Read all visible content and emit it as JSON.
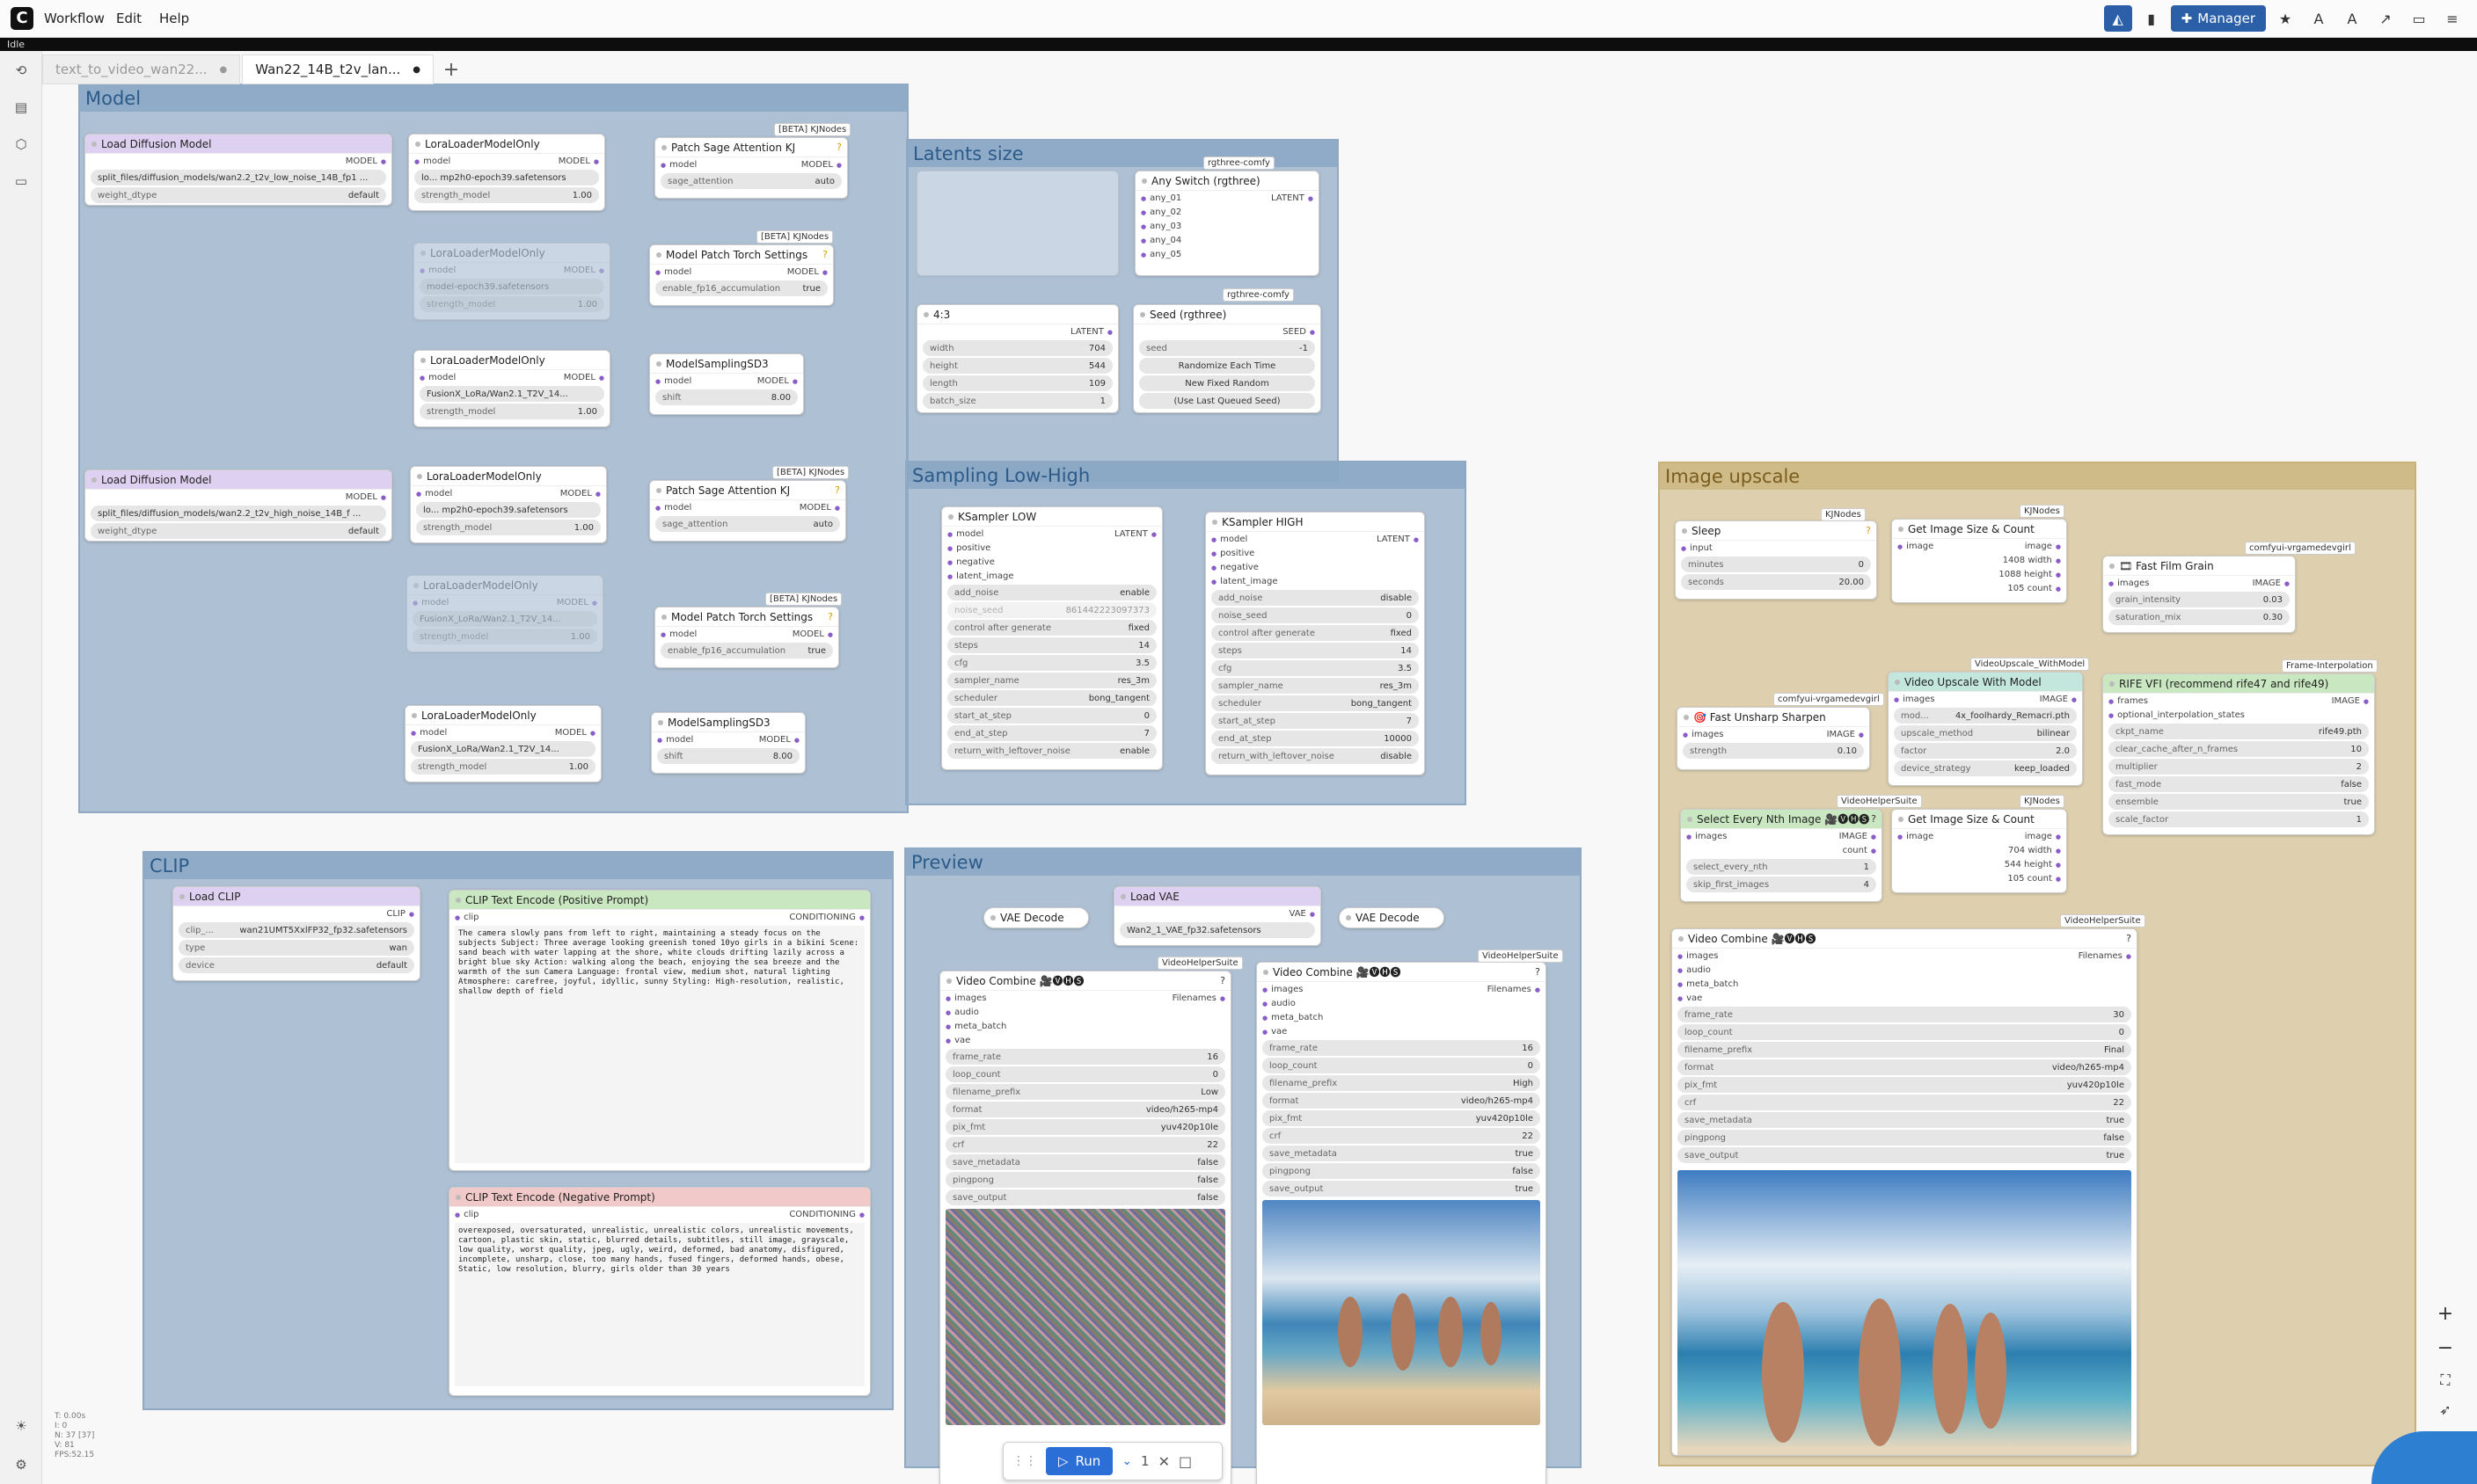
{
  "menu": {
    "items": [
      "Workflow",
      "Edit",
      "Help"
    ],
    "manager": "Manager"
  },
  "status": "Idle",
  "tabs": [
    {
      "label": "text_to_video_wan22...",
      "active": false
    },
    {
      "label": "Wan22_14B_t2v_lan...",
      "active": true
    }
  ],
  "groups": {
    "model": "Model",
    "latents": "Latents size",
    "sampling": "Sampling Low-High",
    "upscale": "Image upscale",
    "clip": "CLIP",
    "preview": "Preview"
  },
  "nodes": {
    "ldm1": {
      "title": "Load Diffusion Model",
      "out": "MODEL",
      "w1": "split_files/diffusion_models/wan2.2_t2v_low_noise_14B_fp1 ...",
      "w2n": "weight_dtype",
      "w2v": "default"
    },
    "ldm2": {
      "title": "Load Diffusion Model",
      "out": "MODEL",
      "w1": "split_files/diffusion_models/wan2.2_t2v_high_noise_14B_f ...",
      "w2n": "weight_dtype",
      "w2v": "default"
    },
    "lora1": {
      "title": "LoraLoaderModelOnly",
      "in": "model",
      "out": "MODEL",
      "w1": "lo... mp2h0-epoch39.safetensors",
      "w2n": "strength_model",
      "w2v": "1.00"
    },
    "lora2": {
      "title": "LoraLoaderModelOnly",
      "in": "model",
      "out": "MODEL",
      "w1": "model-epoch39.safetensors",
      "w2n": "strength_model",
      "w2v": "1.00"
    },
    "lora3": {
      "title": "LoraLoaderModelOnly",
      "in": "model",
      "out": "MODEL",
      "w1": "FusionX_LoRa/Wan2.1_T2V_14...",
      "w2n": "strength_model",
      "w2v": "1.00"
    },
    "lora4": {
      "title": "LoraLoaderModelOnly",
      "in": "model",
      "out": "MODEL",
      "w1": "lo... mp2h0-epoch39.safetensors",
      "w2n": "strength_model",
      "w2v": "1.00"
    },
    "lora5": {
      "title": "LoraLoaderModelOnly",
      "in": "model",
      "out": "MODEL",
      "w1": "FusionX_LoRa/Wan2.1_T2V_14...",
      "w2n": "strength_model",
      "w2v": "1.00"
    },
    "lora6": {
      "title": "LoraLoaderModelOnly",
      "in": "model",
      "out": "MODEL",
      "w1": "FusionX_LoRa/Wan2.1_T2V_14...",
      "w2n": "strength_model",
      "w2v": "1.00"
    },
    "psa1": {
      "title": "Patch Sage Attention KJ",
      "badge": "[BETA] KJNodes",
      "in": "model",
      "out": "MODEL",
      "w1n": "sage_attention",
      "w1v": "auto"
    },
    "psa2": {
      "title": "Patch Sage Attention KJ",
      "badge": "[BETA] KJNodes",
      "in": "model",
      "out": "MODEL",
      "w1n": "sage_attention",
      "w1v": "auto"
    },
    "mpt1": {
      "title": "Model Patch Torch Settings",
      "badge": "[BETA] KJNodes",
      "in": "model",
      "out": "MODEL",
      "w1n": "enable_fp16_accumulation",
      "w1v": "true"
    },
    "mpt2": {
      "title": "Model Patch Torch Settings",
      "badge": "[BETA] KJNodes",
      "in": "model",
      "out": "MODEL",
      "w1n": "enable_fp16_accumulation",
      "w1v": "true"
    },
    "msd1": {
      "title": "ModelSamplingSD3",
      "in": "model",
      "out": "MODEL",
      "w1n": "shift",
      "w1v": "8.00"
    },
    "msd2": {
      "title": "ModelSamplingSD3",
      "in": "model",
      "out": "MODEL",
      "w1n": "shift",
      "w1v": "8.00"
    },
    "anysw": {
      "title": "Any Switch (rgthree)",
      "badge": "rgthree-comfy",
      "out": "LATENT",
      "ins": [
        "any_01",
        "any_02",
        "any_03",
        "any_04",
        "any_05"
      ]
    },
    "ratio": {
      "title": "4:3",
      "out": "LATENT",
      "w": [
        [
          "width",
          "704"
        ],
        [
          "height",
          "544"
        ],
        [
          "length",
          "109"
        ],
        [
          "batch_size",
          "1"
        ]
      ]
    },
    "seed": {
      "title": "Seed (rgthree)",
      "badge": "rgthree-comfy",
      "out": "SEED",
      "w1n": "seed",
      "w1v": "-1",
      "b1": "Randomize Each Time",
      "b2": "New Fixed Random",
      "b3": "(Use Last Queued Seed)"
    },
    "ksl": {
      "title": "KSampler LOW",
      "out": "LATENT",
      "ins": [
        "model",
        "positive",
        "negative",
        "latent_image"
      ],
      "w": [
        [
          "add_noise",
          "enable"
        ],
        [
          "noise_seed",
          "861442223097373"
        ],
        [
          "control after generate",
          "fixed"
        ],
        [
          "steps",
          "14"
        ],
        [
          "cfg",
          "3.5"
        ],
        [
          "sampler_name",
          "res_3m"
        ],
        [
          "scheduler",
          "bong_tangent"
        ],
        [
          "start_at_step",
          "0"
        ],
        [
          "end_at_step",
          "7"
        ],
        [
          "return_with_leftover_noise",
          "enable"
        ]
      ]
    },
    "ksh": {
      "title": "KSampler HIGH",
      "out": "LATENT",
      "ins": [
        "model",
        "positive",
        "negative",
        "latent_image"
      ],
      "w": [
        [
          "add_noise",
          "disable"
        ],
        [
          "noise_seed",
          "0"
        ],
        [
          "control after generate",
          "fixed"
        ],
        [
          "steps",
          "14"
        ],
        [
          "cfg",
          "3.5"
        ],
        [
          "sampler_name",
          "res_3m"
        ],
        [
          "scheduler",
          "bong_tangent"
        ],
        [
          "start_at_step",
          "7"
        ],
        [
          "end_at_step",
          "10000"
        ],
        [
          "return_with_leftover_noise",
          "disable"
        ]
      ]
    },
    "clip": {
      "title": "Load CLIP",
      "out": "CLIP",
      "w": [
        [
          "clip_...",
          "wan21UMT5XxlFP32_fp32.safetensors"
        ],
        [
          "type",
          "wan"
        ],
        [
          "device",
          "default"
        ]
      ]
    },
    "pos": {
      "title": "CLIP Text Encode (Positive Prompt)",
      "in": "clip",
      "out": "CONDITIONING",
      "text": "The camera slowly pans from left to right, maintaining a steady focus on the subjects\nSubject: Three average looking greenish toned 10yo girls in a bikini\nScene: sand beach with water lapping at the shore, white clouds drifting lazily across a bright blue sky\nAction: walking along the beach, enjoying the sea breeze and the warmth of the sun Camera Language: frontal view, medium shot, natural lighting Atmosphere: carefree, joyful, idyllic, sunny Styling: High-resolution, realistic, shallow depth of field"
    },
    "neg": {
      "title": "CLIP Text Encode (Negative Prompt)",
      "in": "clip",
      "out": "CONDITIONING",
      "text": "overexposed, oversaturated, unrealistic, unrealistic colors, unrealistic movements, cartoon, plastic skin, static, blurred details, subtitles, still image, grayscale, low quality, worst quality, jpeg, ugly, weird, deformed, bad anatomy, disfigured, incomplete, unsharp, close, too many hands, fused fingers, deformed hands, obese, Static, low resolution, blurry, girls older than 30 years"
    },
    "vd1": {
      "title": "VAE Decode"
    },
    "vd2": {
      "title": "VAE Decode"
    },
    "vae": {
      "title": "Load VAE",
      "out": "VAE",
      "w1": "Wan2_1_VAE_fp32.safetensors"
    },
    "vc1": {
      "title": "Video Combine 🎥🅥🅗🅢",
      "badge": "VideoHelperSuite",
      "ins": [
        "images",
        "audio",
        "meta_batch",
        "vae"
      ],
      "out": "Filenames",
      "w": [
        [
          "frame_rate",
          "16"
        ],
        [
          "loop_count",
          "0"
        ],
        [
          "filename_prefix",
          "Low"
        ],
        [
          "format",
          "video/h265-mp4"
        ],
        [
          "pix_fmt",
          "yuv420p10le"
        ],
        [
          "crf",
          "22"
        ],
        [
          "save_metadata",
          "false"
        ],
        [
          "pingpong",
          "false"
        ],
        [
          "save_output",
          "false"
        ]
      ]
    },
    "vc2": {
      "title": "Video Combine 🎥🅥🅗🅢",
      "badge": "VideoHelperSuite",
      "ins": [
        "images",
        "audio",
        "meta_batch",
        "vae"
      ],
      "out": "Filenames",
      "w": [
        [
          "frame_rate",
          "16"
        ],
        [
          "loop_count",
          "0"
        ],
        [
          "filename_prefix",
          "High"
        ],
        [
          "format",
          "video/h265-mp4"
        ],
        [
          "pix_fmt",
          "yuv420p10le"
        ],
        [
          "crf",
          "22"
        ],
        [
          "save_metadata",
          "true"
        ],
        [
          "pingpong",
          "false"
        ],
        [
          "save_output",
          "true"
        ]
      ]
    },
    "vc3": {
      "title": "Video Combine 🎥🅥🅗🅢",
      "badge": "VideoHelperSuite",
      "ins": [
        "images",
        "audio",
        "meta_batch",
        "vae"
      ],
      "out": "Filenames",
      "w": [
        [
          "frame_rate",
          "30"
        ],
        [
          "loop_count",
          "0"
        ],
        [
          "filename_prefix",
          "Final"
        ],
        [
          "format",
          "video/h265-mp4"
        ],
        [
          "pix_fmt",
          "yuv420p10le"
        ],
        [
          "crf",
          "22"
        ],
        [
          "save_metadata",
          "true"
        ],
        [
          "pingpong",
          "false"
        ],
        [
          "save_output",
          "true"
        ]
      ]
    },
    "sleep": {
      "title": "Sleep",
      "badge": "KJNodes",
      "in": "input",
      "w": [
        [
          "minutes",
          "0"
        ],
        [
          "seconds",
          "20.00"
        ]
      ]
    },
    "gis1": {
      "title": "Get Image Size & Count",
      "badge": "KJNodes",
      "in": "image",
      "outs": [
        "image",
        "1408 width",
        "1088 height",
        "105 count"
      ]
    },
    "gis2": {
      "title": "Get Image Size & Count",
      "badge": "KJNodes",
      "in": "image",
      "outs": [
        "image",
        "704 width",
        "544 height",
        "105 count"
      ]
    },
    "grain": {
      "title": "🎞 Fast Film Grain",
      "badge": "comfyui-vrgamedevgirl",
      "in": "images",
      "out": "IMAGE",
      "w": [
        [
          "grain_intensity",
          "0.03"
        ],
        [
          "saturation_mix",
          "0.30"
        ]
      ]
    },
    "sharpen": {
      "title": "🎯 Fast Unsharp Sharpen",
      "badge": "comfyui-vrgamedevgirl",
      "in": "images",
      "out": "IMAGE",
      "w": [
        [
          "strength",
          "0.10"
        ]
      ]
    },
    "vum": {
      "title": "Video Upscale With Model",
      "badge": "VideoUpscale_WithModel",
      "in": "images",
      "out": "IMAGE",
      "w": [
        [
          "mod...",
          "4x_foolhardy_Remacri.pth"
        ],
        [
          "upscale_method",
          "bilinear"
        ],
        [
          "factor",
          "2.0"
        ],
        [
          "device_strategy",
          "keep_loaded"
        ]
      ]
    },
    "rife": {
      "title": "RIFE VFI (recommend rife47 and rife49)",
      "badge": "Frame-Interpolation",
      "ins": [
        "frames",
        "optional_interpolation_states"
      ],
      "out": "IMAGE",
      "w": [
        [
          "ckpt_name",
          "rife49.pth"
        ],
        [
          "clear_cache_after_n_frames",
          "10"
        ],
        [
          "multiplier",
          "2"
        ],
        [
          "fast_mode",
          "false"
        ],
        [
          "ensemble",
          "true"
        ],
        [
          "scale_factor",
          "1"
        ]
      ]
    },
    "sen": {
      "title": "Select Every Nth Image 🎥🅥🅗🅢",
      "badge": "VideoHelperSuite",
      "in": "images",
      "outs": [
        "IMAGE",
        "count"
      ],
      "w": [
        [
          "select_every_nth",
          "1"
        ],
        [
          "skip_first_images",
          "4"
        ]
      ]
    }
  },
  "run": {
    "label": "Run",
    "count": "1"
  },
  "stats": [
    "T: 0.00s",
    "I: 0",
    "N: 37 [37]",
    "V: 81",
    "FPS:52.15"
  ],
  "colors": {
    "accent": "#2b5fa8",
    "group_blue": "#8fa8c4",
    "group_sand": "#c8b17b"
  }
}
